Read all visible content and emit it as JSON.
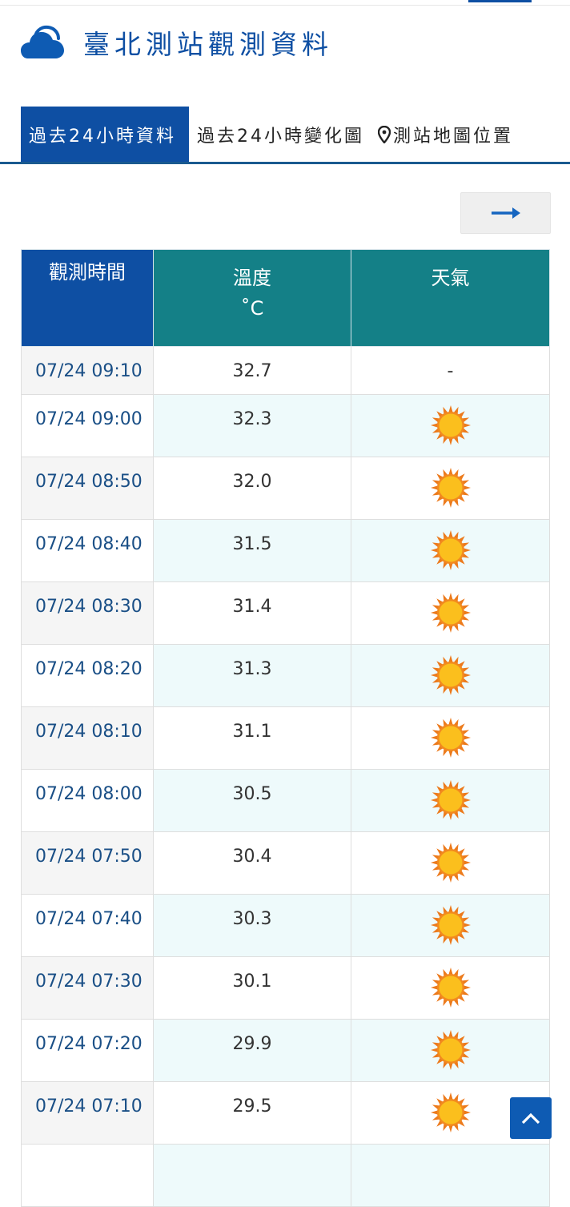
{
  "header": {
    "title": "臺北測站觀測資料",
    "icon": "cloud-icon"
  },
  "tabs": [
    {
      "label": "過去24小時資料",
      "active": true
    },
    {
      "label": "過去24小時變化圖",
      "active": false
    },
    {
      "label": "測站地圖位置",
      "active": false,
      "icon": "map-pin-icon"
    }
  ],
  "next_button": {
    "icon": "arrow-right-icon"
  },
  "table": {
    "headers": {
      "time": "觀測時間",
      "temp": "溫度",
      "temp_unit": "˚C",
      "weather": "天氣"
    },
    "rows": [
      {
        "time": "07/24 09:10",
        "temp": "32.7",
        "weather": "-"
      },
      {
        "time": "07/24 09:00",
        "temp": "32.3",
        "weather": "sun-icon"
      },
      {
        "time": "07/24 08:50",
        "temp": "32.0",
        "weather": "sun-icon"
      },
      {
        "time": "07/24 08:40",
        "temp": "31.5",
        "weather": "sun-icon"
      },
      {
        "time": "07/24 08:30",
        "temp": "31.4",
        "weather": "sun-icon"
      },
      {
        "time": "07/24 08:20",
        "temp": "31.3",
        "weather": "sun-icon"
      },
      {
        "time": "07/24 08:10",
        "temp": "31.1",
        "weather": "sun-icon"
      },
      {
        "time": "07/24 08:00",
        "temp": "30.5",
        "weather": "sun-icon"
      },
      {
        "time": "07/24 07:50",
        "temp": "30.4",
        "weather": "sun-icon"
      },
      {
        "time": "07/24 07:40",
        "temp": "30.3",
        "weather": "sun-icon"
      },
      {
        "time": "07/24 07:30",
        "temp": "30.1",
        "weather": "sun-icon"
      },
      {
        "time": "07/24 07:20",
        "temp": "29.9",
        "weather": "sun-icon"
      },
      {
        "time": "07/24 07:10",
        "temp": "29.5",
        "weather": "sun-icon"
      },
      {
        "time": "",
        "temp": "",
        "weather": ""
      }
    ]
  },
  "back_to_top": {
    "icon": "chevron-up-icon"
  },
  "colors": {
    "brand_blue": "#0e4fa3",
    "teal_header": "#148087",
    "time_text": "#1a4f86",
    "alt_row": "#eefafb"
  }
}
